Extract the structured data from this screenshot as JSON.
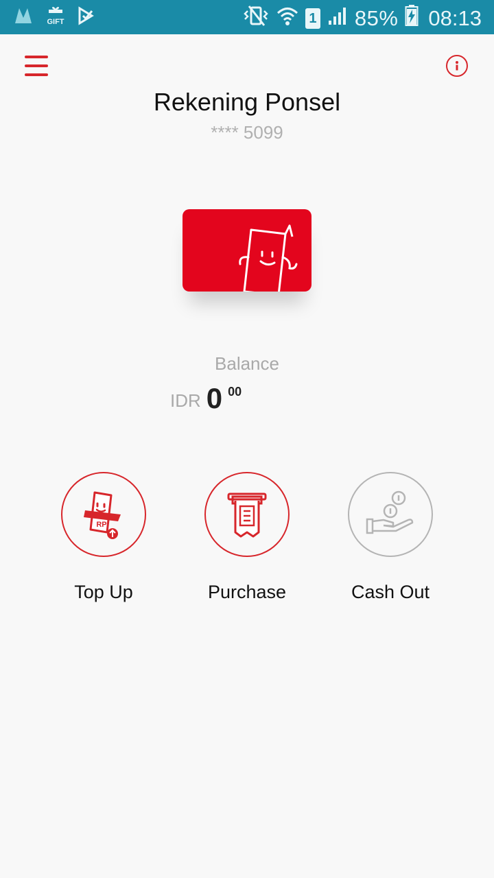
{
  "status_bar": {
    "left_icons": [
      "m-app-icon",
      "gift-icon",
      "play-store-icon"
    ],
    "right_icons": [
      "vibrate-icon",
      "wifi-icon",
      "sim1-icon",
      "signal-icon"
    ],
    "battery_percent": "85%",
    "time": "08:13",
    "sim_slot": "1",
    "background": "#1a8ba7"
  },
  "header": {
    "menu_icon": "hamburger-icon",
    "info_icon": "info-icon",
    "title": "Rekening Ponsel",
    "account_number": "**** 5099"
  },
  "card": {
    "icon": "smiling-phone-icon",
    "color": "#e3051d"
  },
  "balance": {
    "label": "Balance",
    "currency": "IDR",
    "amount": "0",
    "cents": "00"
  },
  "actions": [
    {
      "label": "Top Up",
      "icon": "topup-rp-icon"
    },
    {
      "label": "Purchase",
      "icon": "atm-receipt-icon"
    },
    {
      "label": "Cash Out",
      "icon": "hand-coins-icon"
    }
  ],
  "colors": {
    "accent": "#d7262b",
    "disabled": "#b4b4b4",
    "muted_text": "#a9a9a9"
  }
}
